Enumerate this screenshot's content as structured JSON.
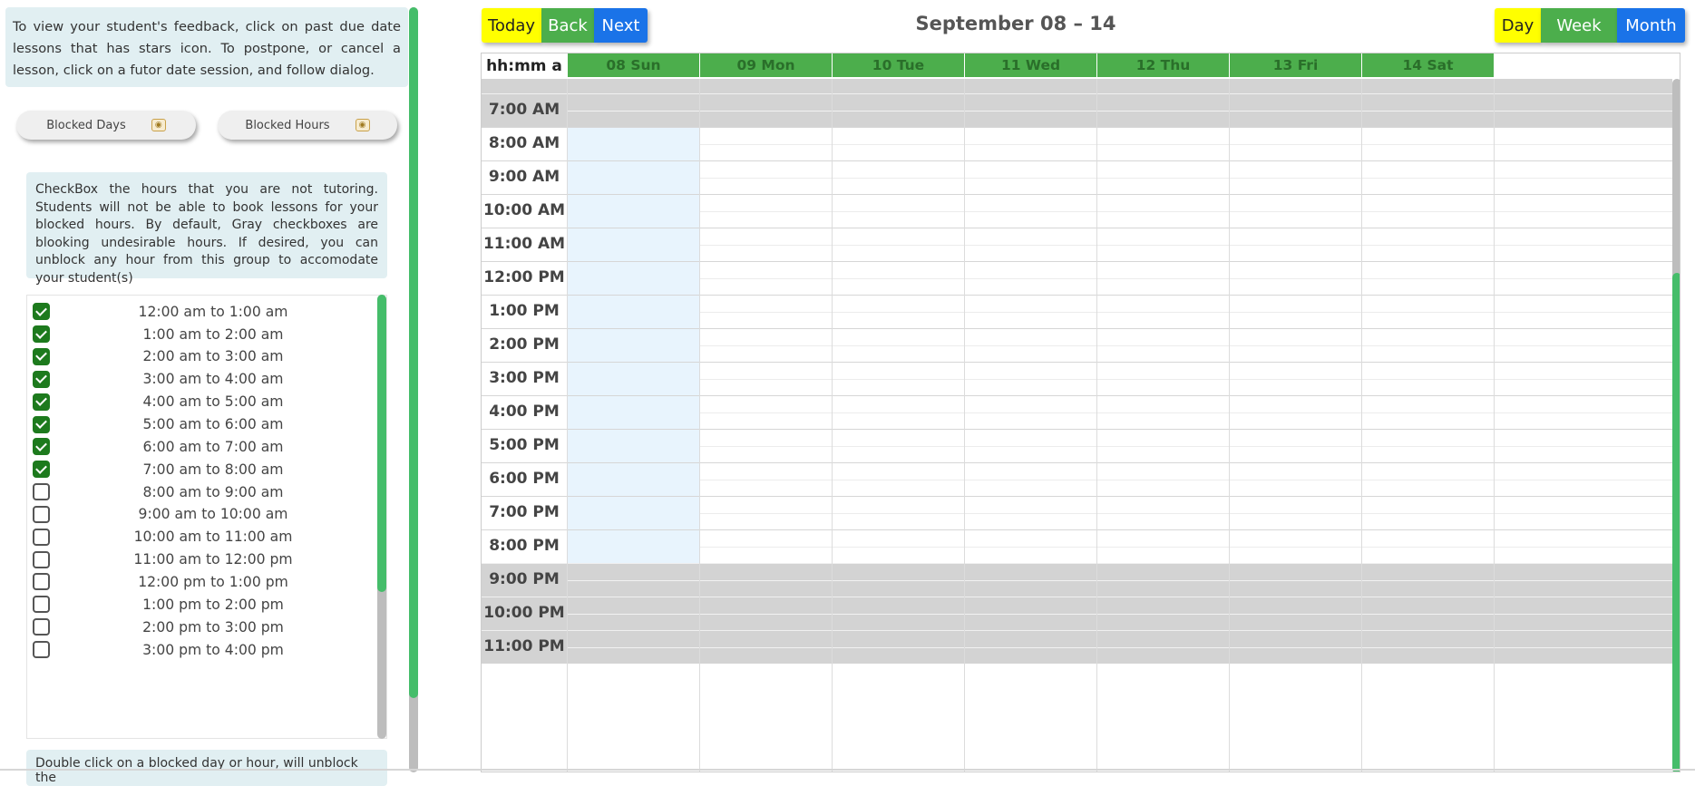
{
  "left_panel": {
    "info_top": "To view your student's feedback, click on past due date lessons that has stars icon. To postpone, or cancel a lesson, click on a futor date session, and follow dialog.",
    "blocked_days_label": "Blocked Days",
    "blocked_hours_label": "Blocked Hours",
    "info_mid": "CheckBox the hours that you are not tutoring. Students will not be able to book lessons for your blocked hours. By default, Gray checkboxes are blooking undesirable hours. If desired, you can unblock any hour from this group to accomodate your student(s)",
    "hours": [
      {
        "label": "12:00 am to 1:00 am",
        "checked": true
      },
      {
        "label": "1:00 am to 2:00 am",
        "checked": true
      },
      {
        "label": "2:00 am to 3:00 am",
        "checked": true
      },
      {
        "label": "3:00 am to 4:00 am",
        "checked": true
      },
      {
        "label": "4:00 am to 5:00 am",
        "checked": true
      },
      {
        "label": "5:00 am to 6:00 am",
        "checked": true
      },
      {
        "label": "6:00 am to 7:00 am",
        "checked": true
      },
      {
        "label": "7:00 am to 8:00 am",
        "checked": true
      },
      {
        "label": "8:00 am to 9:00 am",
        "checked": false
      },
      {
        "label": "9:00 am to 10:00 am",
        "checked": false
      },
      {
        "label": "10:00 am to 11:00 am",
        "checked": false
      },
      {
        "label": "11:00 am to 12:00 pm",
        "checked": false
      },
      {
        "label": "12:00 pm to 1:00 pm",
        "checked": false
      },
      {
        "label": "1:00 pm to 2:00 pm",
        "checked": false
      },
      {
        "label": "2:00 pm to 3:00 pm",
        "checked": false
      },
      {
        "label": "3:00 pm to 4:00 pm",
        "checked": false
      }
    ],
    "info_bottom": "Double click on a blocked day or hour, will unblock the"
  },
  "calendar": {
    "nav": {
      "today": "Today",
      "back": "Back",
      "next": "Next"
    },
    "title": "September 08 – 14",
    "views": {
      "day": "Day",
      "week": "Week",
      "month": "Month"
    },
    "time_format_header": "hh:mm a",
    "days": [
      "08 Sun",
      "09 Mon",
      "10 Tue",
      "11 Wed",
      "12 Thu",
      "13 Fri",
      "14 Sat"
    ],
    "time_slots": [
      {
        "label": "7:00 AM",
        "blocked": true
      },
      {
        "label": "8:00 AM",
        "blocked": false
      },
      {
        "label": "9:00 AM",
        "blocked": false
      },
      {
        "label": "10:00 AM",
        "blocked": false
      },
      {
        "label": "11:00 AM",
        "blocked": false
      },
      {
        "label": "12:00 PM",
        "blocked": false
      },
      {
        "label": "1:00 PM",
        "blocked": false
      },
      {
        "label": "2:00 PM",
        "blocked": false
      },
      {
        "label": "3:00 PM",
        "blocked": false
      },
      {
        "label": "4:00 PM",
        "blocked": false
      },
      {
        "label": "5:00 PM",
        "blocked": false
      },
      {
        "label": "6:00 PM",
        "blocked": false
      },
      {
        "label": "7:00 PM",
        "blocked": false
      },
      {
        "label": "8:00 PM",
        "blocked": false
      },
      {
        "label": "9:00 PM",
        "blocked": true
      },
      {
        "label": "10:00 PM",
        "blocked": true
      },
      {
        "label": "11:00 PM",
        "blocked": true
      }
    ]
  },
  "colors": {
    "accent_green": "#4cae4c",
    "today_yellow": "#ffff00",
    "month_blue": "#1a73e8",
    "blocked_gray": "#d3d3d3",
    "today_column": "#e8f4fd",
    "info_bg": "#e1eff2",
    "scroll_green": "#45bd6a"
  }
}
